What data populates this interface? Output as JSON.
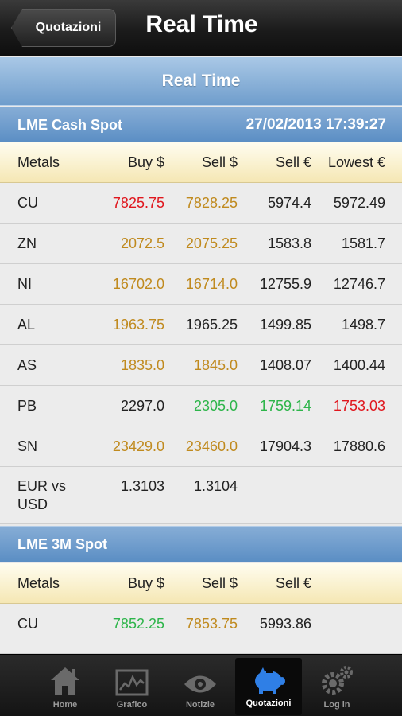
{
  "header": {
    "back_label": "Quotazioni",
    "title": "Real Time"
  },
  "banner": {
    "title": "Real Time"
  },
  "cash_section": {
    "title": "LME Cash Spot",
    "timestamp": "27/02/2013 17:39:27",
    "columns": [
      "Metals",
      "Buy $",
      "Sell $",
      "Sell €",
      "Lowest €"
    ],
    "rows": [
      {
        "metal": "CU",
        "buy": "7825.75",
        "sell": "7828.25",
        "sell_eur": "5974.4",
        "lowest_eur": "5972.49"
      },
      {
        "metal": "ZN",
        "buy": "2072.5",
        "sell": "2075.25",
        "sell_eur": "1583.8",
        "lowest_eur": "1581.7"
      },
      {
        "metal": "NI",
        "buy": "16702.0",
        "sell": "16714.0",
        "sell_eur": "12755.9",
        "lowest_eur": "12746.7"
      },
      {
        "metal": "AL",
        "buy": "1963.75",
        "sell": "1965.25",
        "sell_eur": "1499.85",
        "lowest_eur": "1498.7"
      },
      {
        "metal": "AS",
        "buy": "1835.0",
        "sell": "1845.0",
        "sell_eur": "1408.07",
        "lowest_eur": "1400.44"
      },
      {
        "metal": "PB",
        "buy": "2297.0",
        "sell": "2305.0",
        "sell_eur": "1759.14",
        "lowest_eur": "1753.03"
      },
      {
        "metal": "SN",
        "buy": "23429.0",
        "sell": "23460.0",
        "sell_eur": "17904.3",
        "lowest_eur": "17880.6"
      },
      {
        "metal": "EUR vs USD",
        "buy": "1.3103",
        "sell": "1.3104",
        "sell_eur": "",
        "lowest_eur": ""
      }
    ]
  },
  "three_month_section": {
    "title": "LME 3M Spot",
    "columns": [
      "Metals",
      "Buy $",
      "Sell $",
      "Sell €"
    ],
    "rows": [
      {
        "metal": "CU",
        "buy": "7852.25",
        "sell": "7853.75",
        "sell_eur": "5993.86"
      }
    ]
  },
  "colors": {
    "up": "#c08a1e",
    "down": "#e0161d",
    "rise": "#2db54a",
    "neutral": "#222222",
    "accent": "#6f9dcc"
  },
  "tabs": [
    {
      "label": "Home",
      "icon": "home-icon"
    },
    {
      "label": "Grafico",
      "icon": "chart-icon"
    },
    {
      "label": "Notizie",
      "icon": "eye-icon"
    },
    {
      "label": "Quotazioni",
      "icon": "piggy-bank-icon",
      "active": true
    },
    {
      "label": "Log in",
      "icon": "gears-icon"
    }
  ]
}
